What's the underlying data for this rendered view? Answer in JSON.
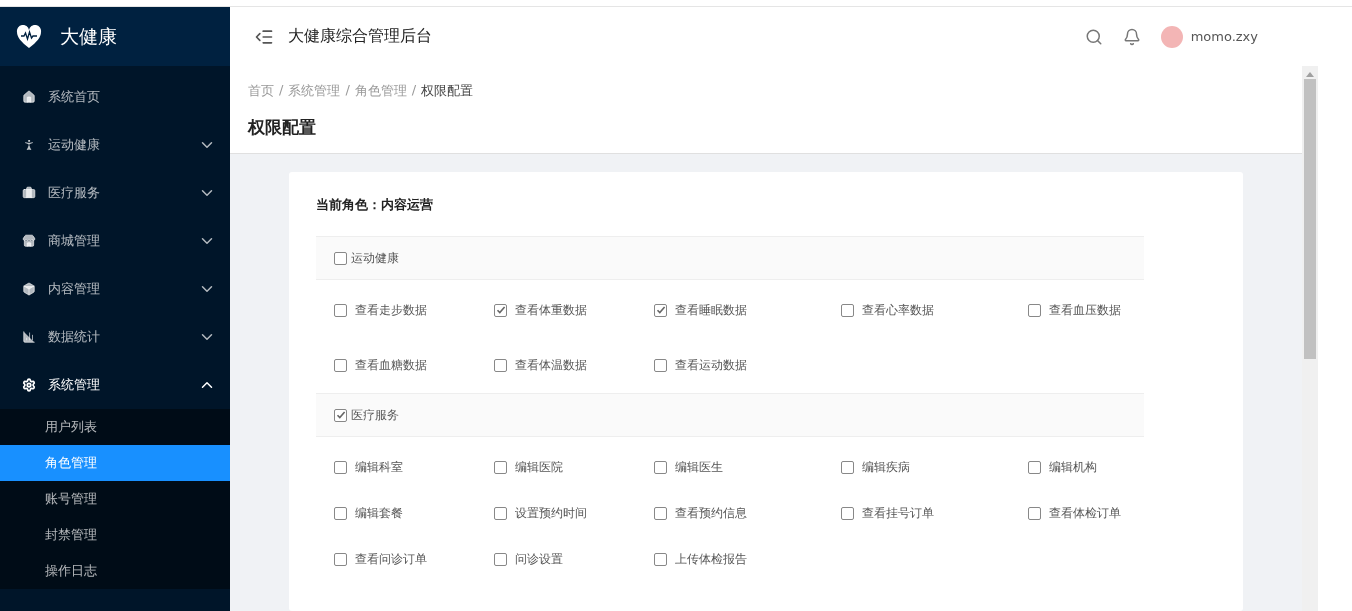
{
  "sidebar": {
    "logo": "大健康",
    "items": [
      {
        "label": "系统首页"
      },
      {
        "label": "运动健康",
        "expanded": false
      },
      {
        "label": "医疗服务",
        "expanded": false
      },
      {
        "label": "商城管理",
        "expanded": false
      },
      {
        "label": "内容管理",
        "expanded": false
      },
      {
        "label": "数据统计",
        "expanded": false
      },
      {
        "label": "系统管理",
        "expanded": true,
        "children": [
          {
            "label": "用户列表",
            "selected": false
          },
          {
            "label": "角色管理",
            "selected": true
          },
          {
            "label": "账号管理",
            "selected": false
          },
          {
            "label": "封禁管理",
            "selected": false
          },
          {
            "label": "操作日志",
            "selected": false
          }
        ]
      }
    ]
  },
  "header": {
    "title": "大健康综合管理后台",
    "user": "momo.zxy"
  },
  "breadcrumb": {
    "items": [
      "首页",
      "系统管理",
      "角色管理",
      "权限配置"
    ],
    "separator": "/"
  },
  "page_title": "权限配置",
  "card": {
    "role_label": "当前角色：内容运营",
    "groups": [
      {
        "label": "运动健康",
        "checked": false,
        "permissions": [
          {
            "label": "查看走步数据",
            "checked": false
          },
          {
            "label": "查看体重数据",
            "checked": true
          },
          {
            "label": "查看睡眠数据",
            "checked": true
          },
          {
            "label": "查看心率数据",
            "checked": false
          },
          {
            "label": "查看血压数据",
            "checked": false
          },
          {
            "label": "查看血糖数据",
            "checked": false
          },
          {
            "label": "查看体温数据",
            "checked": false
          },
          {
            "label": "查看运动数据",
            "checked": false
          }
        ]
      },
      {
        "label": "医疗服务",
        "checked": true,
        "permissions": [
          {
            "label": "编辑科室",
            "checked": false
          },
          {
            "label": "编辑医院",
            "checked": false
          },
          {
            "label": "编辑医生",
            "checked": false
          },
          {
            "label": "编辑疾病",
            "checked": false
          },
          {
            "label": "编辑机构",
            "checked": false
          },
          {
            "label": "编辑套餐",
            "checked": false
          },
          {
            "label": "设置预约时间",
            "checked": false
          },
          {
            "label": "查看预约信息",
            "checked": false
          },
          {
            "label": "查看挂号订单",
            "checked": false
          },
          {
            "label": "查看体检订单",
            "checked": false
          },
          {
            "label": "查看问诊订单",
            "checked": false
          },
          {
            "label": "问诊设置",
            "checked": false
          },
          {
            "label": "上传体检报告",
            "checked": false
          }
        ]
      }
    ]
  }
}
